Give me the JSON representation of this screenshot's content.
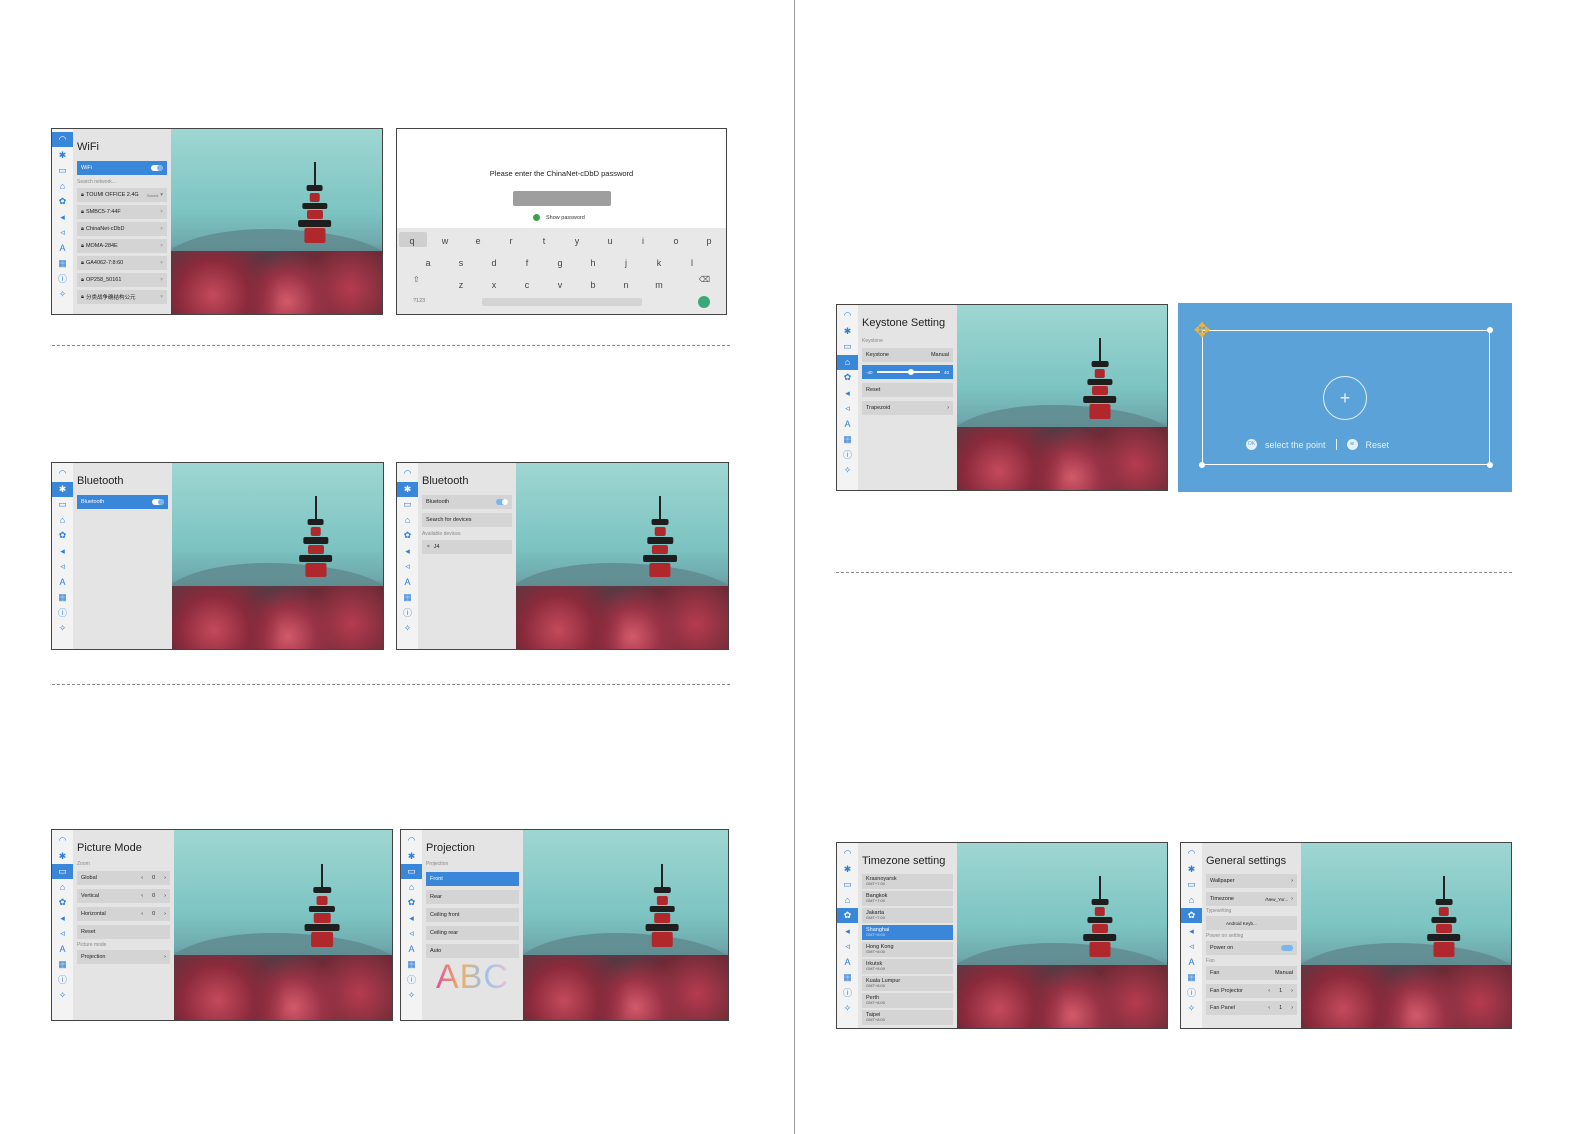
{
  "page": {
    "title": ""
  },
  "wifi_screen": {
    "title": "WiFi",
    "toggle_label": "WiFi",
    "search_label": "Search network...",
    "networks": [
      {
        "name": "TOUMI OFFICE 2.4G",
        "status": "Saved"
      },
      {
        "name": "SMBC5-7:44F",
        "status": ""
      },
      {
        "name": "ChinaNet-cDbD",
        "status": ""
      },
      {
        "name": "MOMA-284E",
        "status": ""
      },
      {
        "name": "GA4062-7:8:60",
        "status": ""
      },
      {
        "name": "OP258_50161",
        "status": ""
      },
      {
        "name": "分类战争确结构公元",
        "status": ""
      }
    ]
  },
  "password_screen": {
    "prompt": "Please enter the ChinaNet-cDbD password",
    "show_password": "Show password",
    "keyboard": {
      "row1": [
        "q",
        "w",
        "e",
        "r",
        "t",
        "y",
        "u",
        "i",
        "o",
        "p"
      ],
      "row2": [
        "a",
        "s",
        "d",
        "f",
        "g",
        "h",
        "j",
        "k",
        "l"
      ],
      "row3": [
        "z",
        "x",
        "c",
        "v",
        "b",
        "n",
        "m"
      ],
      "symbols_key": "?123"
    }
  },
  "bluetooth_screen_1": {
    "title": "Bluetooth",
    "toggle_label": "Bluetooth"
  },
  "bluetooth_screen_2": {
    "title": "Bluetooth",
    "toggle_label": "Bluetooth",
    "search_label": "Search for devices",
    "available_label": "Available devices",
    "device_name": "J4"
  },
  "picture_screen": {
    "title": "Picture Mode",
    "zoom_label": "Zoom",
    "rows": [
      {
        "label": "Global",
        "value": "0"
      },
      {
        "label": "Vertical",
        "value": "0"
      },
      {
        "label": "Horizontal",
        "value": "0"
      }
    ],
    "reset_label": "Reset",
    "picture_mode_label": "Picture mode",
    "projection_label": "Projection"
  },
  "projection_screen": {
    "title": "Projection",
    "sub_label": "Projection",
    "options": [
      "Front",
      "Rear",
      "Ceiling front",
      "Ceiling rear",
      "Auto"
    ],
    "selected": "Front",
    "sample_text": "ABC"
  },
  "keystone_screen": {
    "title": "Keystone Setting",
    "sub_label": "Keystone",
    "mode_label": "Keystone",
    "mode_value": "Manual",
    "slider_min": "-40",
    "slider_max": "40",
    "reset_label": "Reset",
    "trapezoid_label": "Trapezoid"
  },
  "keystone_canvas": {
    "select_label": "select the point",
    "reset_label": "Reset",
    "ok_icon_text": "OK"
  },
  "timezone_screen": {
    "title": "Timezone setting",
    "zones": [
      {
        "city": "Krasnoyarsk",
        "offset": "GMT+7:00"
      },
      {
        "city": "Bangkok",
        "offset": "GMT+7:00"
      },
      {
        "city": "Jakarta",
        "offset": "GMT+7:00"
      },
      {
        "city": "Shanghai",
        "offset": "GMT+8:00"
      },
      {
        "city": "Hong Kong",
        "offset": "GMT+8:00"
      },
      {
        "city": "Irkutsk",
        "offset": "GMT+8:00"
      },
      {
        "city": "Kuala Lumpur",
        "offset": "GMT+8:00"
      },
      {
        "city": "Perth",
        "offset": "GMT+8:00"
      },
      {
        "city": "Taipei",
        "offset": "GMT+8:00"
      }
    ],
    "selected": "Shanghai"
  },
  "general_screen": {
    "title": "General settings",
    "wallpaper_label": "Wallpaper",
    "timezone_label": "Timezone",
    "timezone_value": "/New_Yor...",
    "typewriting_label": "Typewriting",
    "keyboard_value": "Android Keyb...",
    "power_label": "Power on setting",
    "power_on_label": "Power on",
    "fan_section": "Fan",
    "fan_label": "Fan",
    "fan_value": "Manual",
    "fan_projector_label": "Fan Projector",
    "fan_projector_value": "1",
    "fan_panel_label": "Fan Panel",
    "fan_panel_value": "1"
  },
  "icons": [
    "wifi-icon",
    "bluetooth-icon",
    "display-icon",
    "projection-icon",
    "settings-icon",
    "speaker-icon",
    "volume-icon",
    "language-icon",
    "apps-icon",
    "info-icon",
    "system-icon"
  ],
  "colors": {
    "accent": "#3a86d8",
    "keystone_bg": "#5aa2d7",
    "tree_red": "#b0282c"
  }
}
